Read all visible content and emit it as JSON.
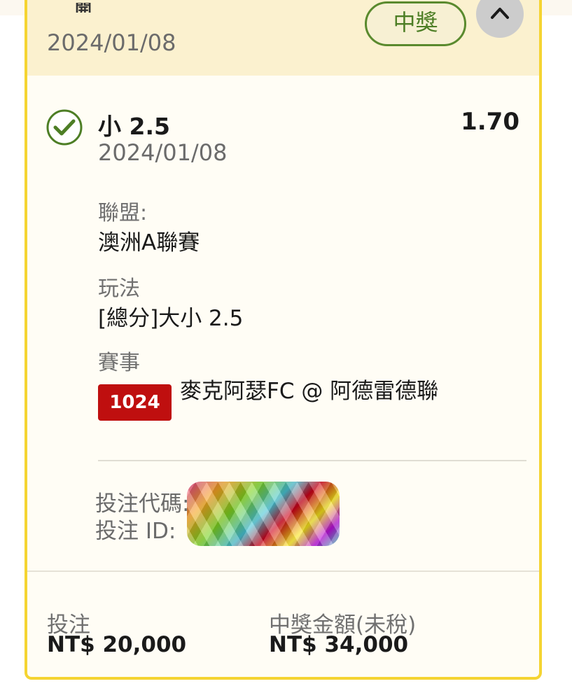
{
  "header": {
    "cut_text": "開",
    "date": "2024/01/08",
    "status_badge": "中獎"
  },
  "selection": {
    "name": "小 2.5",
    "odds": "1.70",
    "date": "2024/01/08"
  },
  "details": {
    "league_label": "聯盟:",
    "league_value": "澳洲A聯賽",
    "market_label": "玩法",
    "market_value": "[總分]大小 2.5",
    "event_label": "賽事",
    "event_id": "1024",
    "event_name": "麥克阿瑟FC @ 阿德雷德聯"
  },
  "codes": {
    "bet_code_label": "投注代碼::",
    "bet_id_label": "投注 ID:"
  },
  "footer": {
    "stake_label": "投注",
    "stake_value": "NT$ 20,000",
    "payout_label": "中獎金額(未稅)",
    "payout_value": "NT$ 34,000"
  },
  "colors": {
    "accent_border": "#f5d432",
    "header_bg": "#fbf1cf",
    "win_green": "#4d7e25",
    "event_badge_red": "#bf0f0f"
  },
  "icons": {
    "check": "check-circle-icon",
    "collapse": "chevron-up-icon"
  }
}
